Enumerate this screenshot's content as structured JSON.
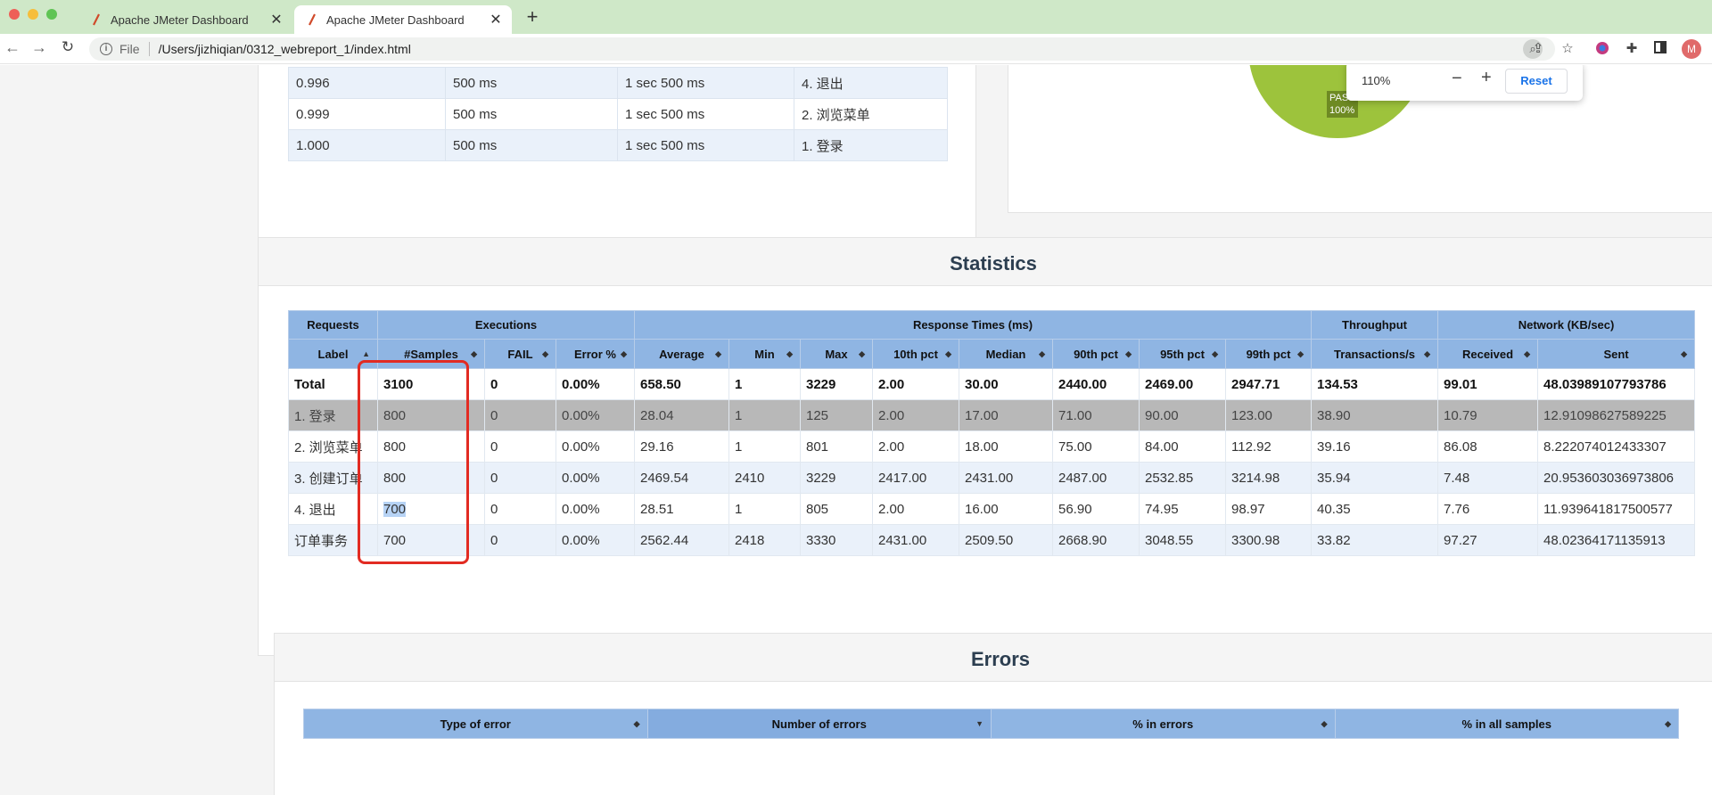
{
  "browser": {
    "tabs": [
      {
        "title": "Apache JMeter Dashboard",
        "active": false
      },
      {
        "title": "Apache JMeter Dashboard",
        "active": true
      }
    ],
    "file_label": "File",
    "url": "/Users/jizhiqian/0312_webreport_1/index.html",
    "avatar_letter": "M"
  },
  "zoom_popup": {
    "level": "110%",
    "reset_label": "Reset"
  },
  "pie": {
    "label_top": "PASS",
    "label_bottom": "100%"
  },
  "top_table": {
    "rows": [
      [
        "0.996",
        "500 ms",
        "1 sec 500 ms",
        "4. 退出"
      ],
      [
        "0.999",
        "500 ms",
        "1 sec 500 ms",
        "2. 浏览菜单"
      ],
      [
        "1.000",
        "500 ms",
        "1 sec 500 ms",
        "1. 登录"
      ]
    ]
  },
  "statistics": {
    "title": "Statistics",
    "groups": [
      "Requests",
      "Executions",
      "Response Times (ms)",
      "Throughput",
      "Network (KB/sec)"
    ],
    "columns": [
      "Label",
      "#Samples",
      "FAIL",
      "Error %",
      "Average",
      "Min",
      "Max",
      "10th pct",
      "Median",
      "90th pct",
      "95th pct",
      "99th pct",
      "Transactions/s",
      "Received",
      "Sent"
    ],
    "rows": [
      [
        "Total",
        "3100",
        "0",
        "0.00%",
        "658.50",
        "1",
        "3229",
        "2.00",
        "30.00",
        "2440.00",
        "2469.00",
        "2947.71",
        "134.53",
        "99.01",
        "48.03989107793786"
      ],
      [
        "1. 登录",
        "800",
        "0",
        "0.00%",
        "28.04",
        "1",
        "125",
        "2.00",
        "17.00",
        "71.00",
        "90.00",
        "123.00",
        "38.90",
        "10.79",
        "12.91098627589225"
      ],
      [
        "2. 浏览菜单",
        "800",
        "0",
        "0.00%",
        "29.16",
        "1",
        "801",
        "2.00",
        "18.00",
        "75.00",
        "84.00",
        "112.92",
        "39.16",
        "86.08",
        "8.222074012433307"
      ],
      [
        "3. 创建订单",
        "800",
        "0",
        "0.00%",
        "2469.54",
        "2410",
        "3229",
        "2417.00",
        "2431.00",
        "2487.00",
        "2532.85",
        "3214.98",
        "35.94",
        "7.48",
        "20.953603036973806"
      ],
      [
        "4. 退出",
        "700",
        "0",
        "0.00%",
        "28.51",
        "1",
        "805",
        "2.00",
        "16.00",
        "56.90",
        "74.95",
        "98.97",
        "40.35",
        "7.76",
        "11.939641817500577"
      ],
      [
        "订单事务",
        "700",
        "0",
        "0.00%",
        "2562.44",
        "2418",
        "3330",
        "2431.00",
        "2509.50",
        "2668.90",
        "3048.55",
        "3300.98",
        "33.82",
        "97.27",
        "48.02364171135913"
      ]
    ]
  },
  "errors": {
    "title": "Errors",
    "columns": [
      "Type of error",
      "Number of errors",
      "% in errors",
      "% in all samples"
    ]
  },
  "colors": {
    "accent_blue": "#8fb5e3",
    "highlight_red": "#e22b22",
    "pie_green": "#9dc33c"
  }
}
